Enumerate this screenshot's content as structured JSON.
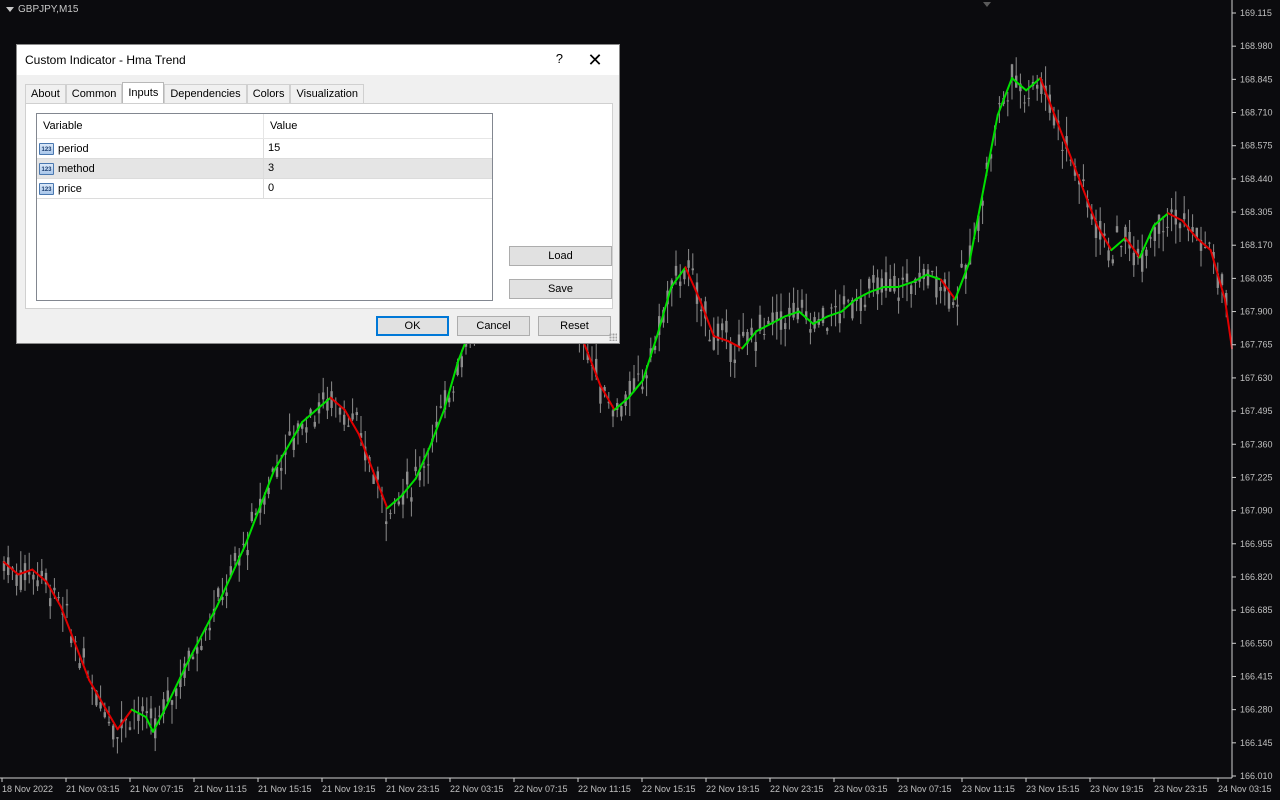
{
  "chart": {
    "symbol": "GBPJPY,M15",
    "price_axis": [
      "169.115",
      "168.980",
      "168.845",
      "168.710",
      "168.575",
      "168.440",
      "168.305",
      "168.170",
      "168.035",
      "167.900",
      "167.765",
      "167.630",
      "167.495",
      "167.360",
      "167.225",
      "167.090",
      "166.955",
      "166.820",
      "166.685",
      "166.550",
      "166.415",
      "166.280",
      "166.145",
      "166.010"
    ],
    "time_axis": [
      "18 Nov 2022",
      "21 Nov 03:15",
      "21 Nov 07:15",
      "21 Nov 11:15",
      "21 Nov 15:15",
      "21 Nov 19:15",
      "21 Nov 23:15",
      "22 Nov 03:15",
      "22 Nov 07:15",
      "22 Nov 11:15",
      "22 Nov 15:15",
      "22 Nov 19:15",
      "22 Nov 23:15",
      "23 Nov 03:15",
      "23 Nov 07:15",
      "23 Nov 11:15",
      "23 Nov 15:15",
      "23 Nov 19:15",
      "23 Nov 23:15",
      "24 Nov 03:15"
    ],
    "colors": {
      "background": "#0b0b0e",
      "candles": "#8c8c8c",
      "up_trend": "#00e000",
      "down_trend": "#e00000",
      "grid_text": "#c0c0c0"
    },
    "hma_path": [
      [
        18.0,
        166.88
      ],
      [
        18.1,
        166.83
      ],
      [
        18.2,
        166.85
      ],
      [
        18.3,
        166.8
      ],
      [
        18.4,
        166.7
      ],
      [
        18.5,
        166.55
      ],
      [
        18.6,
        166.4
      ],
      [
        18.7,
        166.3
      ],
      [
        18.8,
        166.2
      ],
      [
        18.9,
        166.28
      ],
      [
        19.0,
        166.25
      ],
      [
        19.05,
        166.19
      ],
      [
        19.15,
        166.3
      ],
      [
        19.3,
        166.48
      ],
      [
        19.5,
        166.7
      ],
      [
        19.7,
        166.95
      ],
      [
        19.9,
        167.25
      ],
      [
        20.1,
        167.45
      ],
      [
        20.3,
        167.55
      ],
      [
        20.4,
        167.5
      ],
      [
        20.5,
        167.4
      ],
      [
        20.6,
        167.25
      ],
      [
        20.7,
        167.1
      ],
      [
        20.8,
        167.15
      ],
      [
        20.9,
        167.22
      ],
      [
        21.0,
        167.35
      ],
      [
        21.1,
        167.5
      ],
      [
        21.2,
        167.7
      ],
      [
        21.3,
        167.85
      ],
      [
        21.4,
        168.0
      ],
      [
        21.5,
        168.1
      ],
      [
        21.6,
        168.12
      ],
      [
        21.7,
        168.05
      ],
      [
        21.8,
        167.95
      ],
      [
        21.9,
        167.85
      ],
      [
        22.0,
        167.9
      ],
      [
        22.1,
        167.75
      ],
      [
        22.2,
        167.6
      ],
      [
        22.3,
        167.5
      ],
      [
        22.4,
        167.55
      ],
      [
        22.5,
        167.62
      ],
      [
        22.6,
        167.8
      ],
      [
        22.7,
        168.0
      ],
      [
        22.8,
        168.08
      ],
      [
        22.9,
        167.95
      ],
      [
        23.0,
        167.8
      ],
      [
        23.1,
        167.78
      ],
      [
        23.2,
        167.75
      ],
      [
        23.3,
        167.82
      ],
      [
        23.4,
        167.85
      ],
      [
        23.5,
        167.88
      ],
      [
        23.6,
        167.9
      ],
      [
        23.7,
        167.85
      ],
      [
        23.8,
        167.88
      ],
      [
        23.9,
        167.9
      ],
      [
        24.0,
        167.95
      ],
      [
        24.1,
        167.98
      ],
      [
        24.2,
        168.0
      ],
      [
        24.3,
        168.0
      ],
      [
        24.4,
        168.02
      ],
      [
        24.5,
        168.05
      ],
      [
        24.6,
        168.03
      ],
      [
        24.7,
        167.95
      ],
      [
        24.8,
        168.1
      ],
      [
        24.9,
        168.4
      ],
      [
        25.0,
        168.7
      ],
      [
        25.1,
        168.85
      ],
      [
        25.2,
        168.8
      ],
      [
        25.3,
        168.85
      ],
      [
        25.4,
        168.7
      ],
      [
        25.5,
        168.55
      ],
      [
        25.6,
        168.4
      ],
      [
        25.7,
        168.25
      ],
      [
        25.8,
        168.15
      ],
      [
        25.9,
        168.2
      ],
      [
        26.0,
        168.12
      ],
      [
        26.1,
        168.25
      ],
      [
        26.2,
        168.3
      ],
      [
        26.3,
        168.27
      ],
      [
        26.4,
        168.2
      ],
      [
        26.5,
        168.15
      ],
      [
        26.6,
        167.95
      ],
      [
        26.65,
        167.75
      ]
    ],
    "up_segments": [
      [
        18.9,
        19.05
      ],
      [
        19.05,
        20.3
      ],
      [
        20.7,
        21.6
      ],
      [
        22.3,
        22.8
      ],
      [
        23.2,
        24.6
      ],
      [
        24.7,
        25.3
      ],
      [
        25.8,
        25.9
      ],
      [
        26.0,
        26.2
      ]
    ]
  },
  "dialog": {
    "title": "Custom Indicator - Hma Trend",
    "help_label": "?",
    "close_label": "✕",
    "tabs": [
      "About",
      "Common",
      "Inputs",
      "Dependencies",
      "Colors",
      "Visualization"
    ],
    "active_tab": "Inputs",
    "grid": {
      "headers": {
        "variable": "Variable",
        "value": "Value"
      },
      "rows": [
        {
          "icon": "123",
          "name": "period",
          "value": "15"
        },
        {
          "icon": "123",
          "name": "method",
          "value": "3"
        },
        {
          "icon": "123",
          "name": "price",
          "value": "0"
        }
      ]
    },
    "load_label": "Load",
    "save_label": "Save",
    "ok_label": "OK",
    "cancel_label": "Cancel",
    "reset_label": "Reset"
  }
}
